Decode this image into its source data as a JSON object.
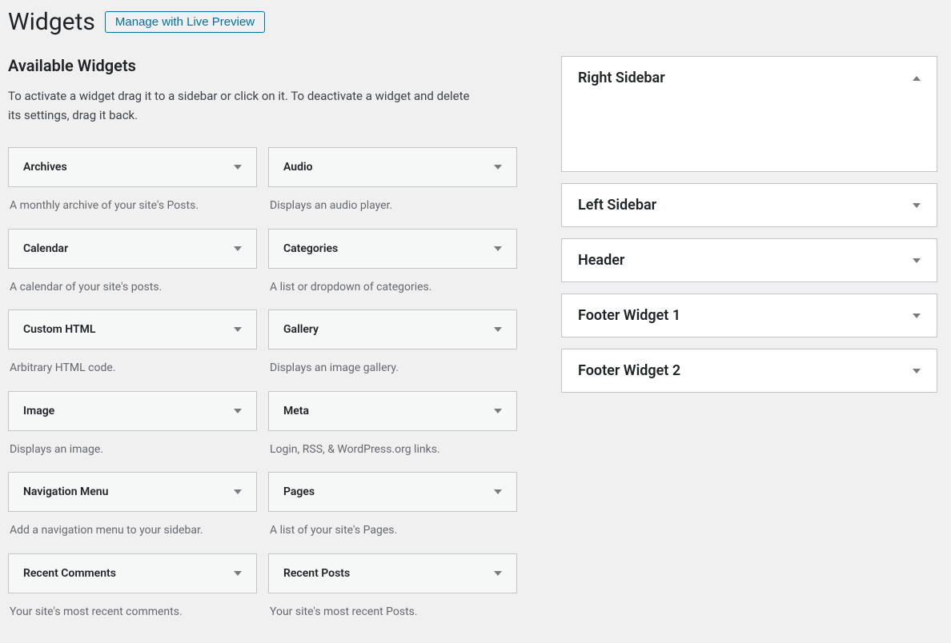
{
  "header": {
    "title": "Widgets",
    "preview_button": "Manage with Live Preview"
  },
  "available": {
    "heading": "Available Widgets",
    "description": "To activate a widget drag it to a sidebar or click on it. To deactivate a widget and delete its settings, drag it back."
  },
  "widgets": [
    {
      "name": "Archives",
      "desc": "A monthly archive of your site's Posts."
    },
    {
      "name": "Audio",
      "desc": "Displays an audio player."
    },
    {
      "name": "Calendar",
      "desc": "A calendar of your site's posts."
    },
    {
      "name": "Categories",
      "desc": "A list or dropdown of categories."
    },
    {
      "name": "Custom HTML",
      "desc": "Arbitrary HTML code."
    },
    {
      "name": "Gallery",
      "desc": "Displays an image gallery."
    },
    {
      "name": "Image",
      "desc": "Displays an image."
    },
    {
      "name": "Meta",
      "desc": "Login, RSS, & WordPress.org links."
    },
    {
      "name": "Navigation Menu",
      "desc": "Add a navigation menu to your sidebar."
    },
    {
      "name": "Pages",
      "desc": "A list of your site's Pages."
    },
    {
      "name": "Recent Comments",
      "desc": "Your site's most recent comments."
    },
    {
      "name": "Recent Posts",
      "desc": "Your site's most recent Posts."
    }
  ],
  "sidebars": [
    {
      "name": "Right Sidebar",
      "expanded": true
    },
    {
      "name": "Left Sidebar",
      "expanded": false
    },
    {
      "name": "Header",
      "expanded": false
    },
    {
      "name": "Footer Widget 1",
      "expanded": false
    },
    {
      "name": "Footer Widget 2",
      "expanded": false
    }
  ]
}
